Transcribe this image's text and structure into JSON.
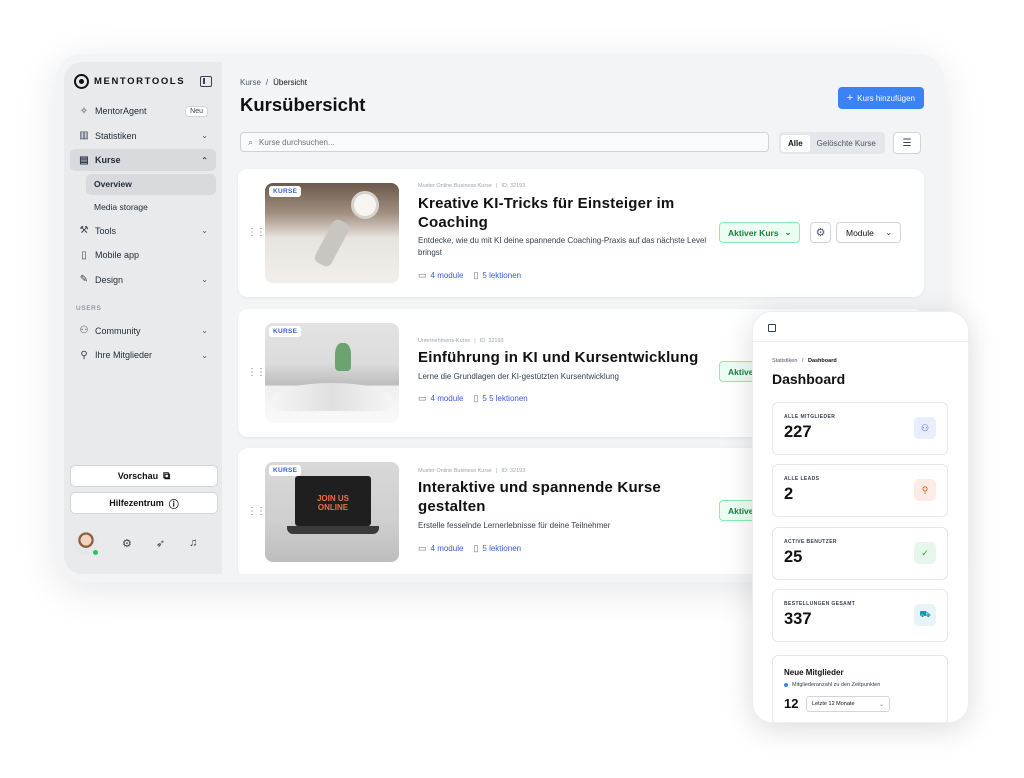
{
  "brand": {
    "name": "MENTORTOOLS"
  },
  "sidebar": {
    "items": [
      {
        "label": "MentorAgent",
        "icon": "sparkle-icon",
        "badge": "Neu"
      },
      {
        "label": "Statistiken",
        "icon": "bar-chart-icon"
      },
      {
        "label": "Kurse",
        "icon": "book-icon"
      }
    ],
    "kurse_sub": [
      {
        "label": "Overview"
      },
      {
        "label": "Media storage"
      }
    ],
    "items_after": [
      {
        "label": "Tools",
        "icon": "tools-icon"
      },
      {
        "label": "Mobile app",
        "icon": "mobile-icon"
      },
      {
        "label": "Design",
        "icon": "pen-icon"
      }
    ],
    "section_users": "USERS",
    "users_items": [
      {
        "label": "Community",
        "icon": "users-icon"
      },
      {
        "label": "Ihre Mitglieder",
        "icon": "user-icon"
      }
    ],
    "preview_label": "Vorschau",
    "help_label": "Hilfezentrum"
  },
  "header": {
    "breadcrumb_root": "Kurse",
    "breadcrumb_sep": "/",
    "breadcrumb_current": "Übersicht",
    "title": "Kursübersicht",
    "add_button": "Kurs hinzufügen"
  },
  "toolbar": {
    "search_placeholder": "Kurse durchsuchen...",
    "filter_all": "Alle",
    "filter_deleted": "Gelöschte Kurse"
  },
  "courses": [
    {
      "tag": "KURSE",
      "category": "Muster Online Business Kurse",
      "id": "ID: 32193",
      "title": "Kreative KI-Tricks für Einsteiger im Coaching",
      "description": "Entdecke, wie du mit KI deine spannende Coaching-Praxis auf das nächste Level bringst",
      "modules": "4 module",
      "lessons": "5 lektionen",
      "status": "Aktiver Kurs",
      "module_button": "Module"
    },
    {
      "tag": "KURSE",
      "category": "Unternehmens-Kurse",
      "id": "ID: 32193",
      "title": "Einführung in KI und Kursentwicklung",
      "description": "Lerne die Grundlagen der KI-gestützten Kursentwicklung",
      "modules": "4 module",
      "lessons": "5 5 lektionen",
      "status": "Aktiver"
    },
    {
      "tag": "KURSE",
      "category": "Muster Online Business Kurse",
      "id": "ID: 32193",
      "title": "Interaktive und spannende Kurse gestalten",
      "description": "Erstelle fesselnde Lernerlebnisse für deine Teilnehmer",
      "modules": "4 module",
      "lessons": "5 lektionen",
      "status": "Aktiver",
      "screen_text": "JOIN US ONLINE"
    }
  ],
  "mobile": {
    "breadcrumb_root": "Statistiken",
    "breadcrumb_sep": "/",
    "breadcrumb_current": "Dashboard",
    "title": "Dashboard",
    "stats": [
      {
        "label": "ALLE MITGLIEDER",
        "value": "227",
        "icon": "users-icon",
        "color": "#e8eefc"
      },
      {
        "label": "ALLE LEADS",
        "value": "2",
        "icon": "user-plus-icon",
        "color": "#fdece6"
      },
      {
        "label": "ACTIVE BENUTZER",
        "value": "25",
        "icon": "user-check-icon",
        "color": "#e7f6ec"
      },
      {
        "label": "BESTELLUNGEN GESAMT",
        "value": "337",
        "icon": "cart-icon",
        "color": "#e6f4f7"
      }
    ],
    "new_members": {
      "title": "Neue Mitglieder",
      "subtitle": "Mitgliederanzahl zu den Zeitpunkten",
      "value": "12",
      "range": "Letzte 12 Monate"
    }
  }
}
